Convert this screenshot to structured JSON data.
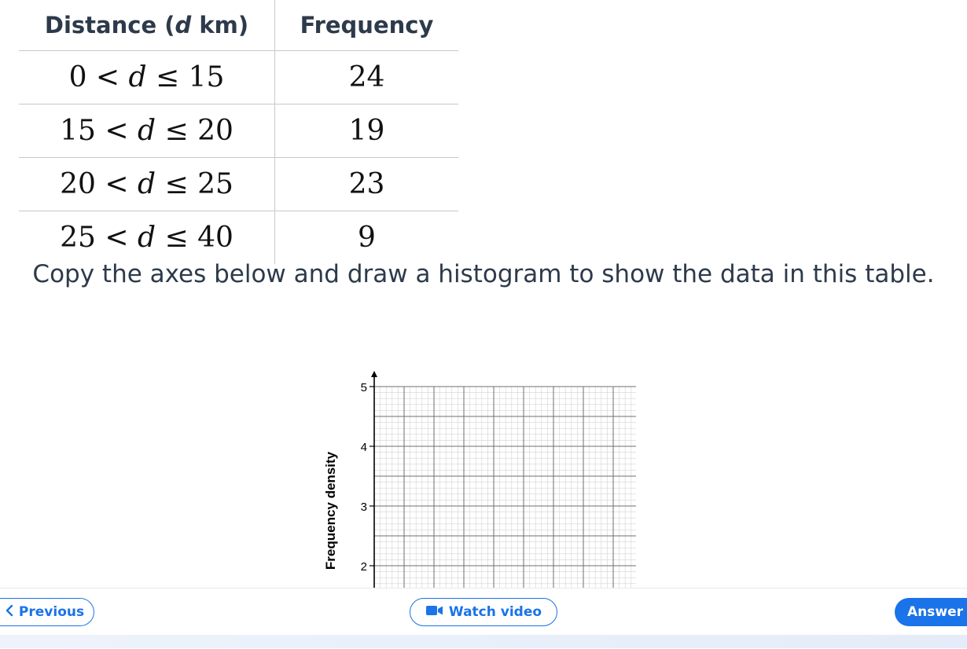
{
  "table": {
    "headers": [
      "Distance (d km)",
      "Frequency"
    ],
    "rows": [
      {
        "range": "0 < d ≤ 15",
        "frequency": "24"
      },
      {
        "range": "15 < d ≤ 20",
        "frequency": "19"
      },
      {
        "range": "20 < d ≤ 25",
        "frequency": "23"
      },
      {
        "range": "25 < d ≤ 40",
        "frequency": "9"
      }
    ]
  },
  "instruction": "Copy the axes below and draw a histogram to show the data in this table.",
  "chart_data": {
    "type": "histogram-axes",
    "ylabel": "Frequency density",
    "y_ticks": [
      2,
      3,
      4,
      5
    ],
    "ylim_visible": [
      2,
      5.2
    ],
    "grid": true
  },
  "nav": {
    "previous_label": "Previous",
    "video_label": "Watch video",
    "answer_label": "Answer"
  },
  "icons": {
    "previous": "chevron-left-icon",
    "video": "video-camera-icon"
  },
  "colors": {
    "accent": "#1a73e8",
    "text": "#2d3a4b"
  }
}
